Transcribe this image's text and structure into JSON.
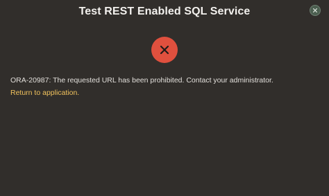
{
  "dialog": {
    "title": "Test REST Enabled SQL Service",
    "close_icon": "close-icon",
    "status_icon": "error-x-icon",
    "message": "ORA-20987: The requested URL has been prohibited. Contact your administrator.",
    "return_link": "Return to application."
  },
  "colors": {
    "background": "#312e2b",
    "title": "#f3f1ee",
    "error_red": "#e0503e",
    "message_text": "#e2dfdb",
    "link": "#f1c25d",
    "close_button": "#4b5e4f"
  }
}
